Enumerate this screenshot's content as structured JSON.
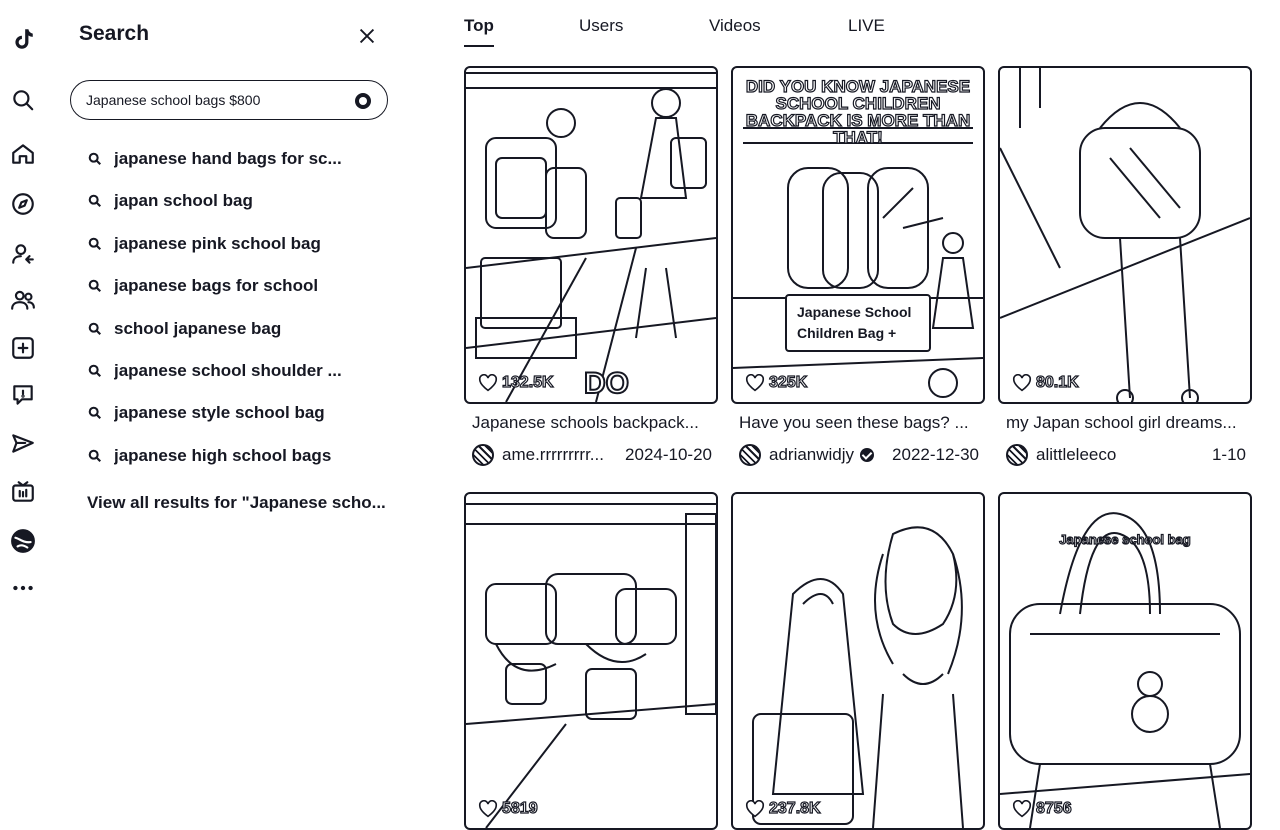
{
  "rail": {
    "icons": [
      "tiktok-logo-icon",
      "search-icon",
      "home-icon",
      "explore-icon",
      "following-icon",
      "friends-icon",
      "upload-icon",
      "activity-icon",
      "messages-icon",
      "live-icon",
      "profile-avatar",
      "more-icon"
    ]
  },
  "search": {
    "title": "Search",
    "query": "Japanese school bags $800",
    "suggestions": [
      "japanese hand bags for sc...",
      "japan school bag",
      "japanese pink school bag",
      "japanese bags for school",
      "school japanese bag",
      "japanese school shoulder ...",
      "japanese style school bag",
      "japanese high school bags"
    ],
    "view_all": "View all results for \"Japanese scho..."
  },
  "tabs": [
    "Top",
    "Users",
    "Videos",
    "LIVE"
  ],
  "active_tab": "Top",
  "videos": [
    {
      "likes": "132.5K",
      "overlay": "DO",
      "title": "Japanese schools backpack...",
      "user": "ame.rrrrrrrrr...",
      "verified": false,
      "date": "2024-10-20"
    },
    {
      "likes": "325K",
      "overlay": "DID YOU KNOW JAPANESE SCHOOL CHILDREN BACKPACK IS MORE THAN THAT!",
      "badge": "Japanese School Children Bag +",
      "title": "Have you seen these bags? ...",
      "user": "adrianwidjy",
      "verified": true,
      "date": "2022-12-30"
    },
    {
      "likes": "80.1K",
      "title": "my Japan school girl dreams...",
      "user": "alittleleeco",
      "verified": false,
      "date": "1-10"
    },
    {
      "likes": "5819",
      "title": "",
      "user": "",
      "date": ""
    },
    {
      "likes": "237.8K",
      "title": "",
      "user": "",
      "date": ""
    },
    {
      "likes": "8756",
      "overlay": "Japanese school bag",
      "title": "",
      "user": "",
      "date": ""
    }
  ]
}
